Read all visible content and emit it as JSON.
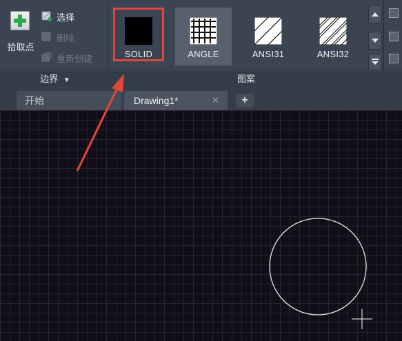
{
  "ribbon": {
    "boundary_panel": {
      "title": "边界",
      "pick_point_label": "拾取点",
      "pick_point_icon": "plus-icon",
      "select_label": "选择",
      "delete_label": "删除",
      "recreate_label": "重新创建"
    },
    "pattern_panel": {
      "title": "图案",
      "items": [
        {
          "label": "SOLID",
          "icon": "solid-fill-icon",
          "selected": true
        },
        {
          "label": "ANGLE",
          "icon": "grid-pattern-icon",
          "selected": false
        },
        {
          "label": "ANSI31",
          "icon": "diagonal-hatch-icon",
          "selected": false
        },
        {
          "label": "ANSI32",
          "icon": "double-diagonal-hatch-icon",
          "selected": false
        }
      ]
    }
  },
  "tabs": {
    "start_label": "开始",
    "active_label": "Drawing1*",
    "close_symbol": "✕",
    "add_symbol": "+"
  },
  "colors": {
    "highlight": "#e3473c",
    "canvas_bg": "#110e17",
    "ribbon_bg": "#3b4453"
  }
}
